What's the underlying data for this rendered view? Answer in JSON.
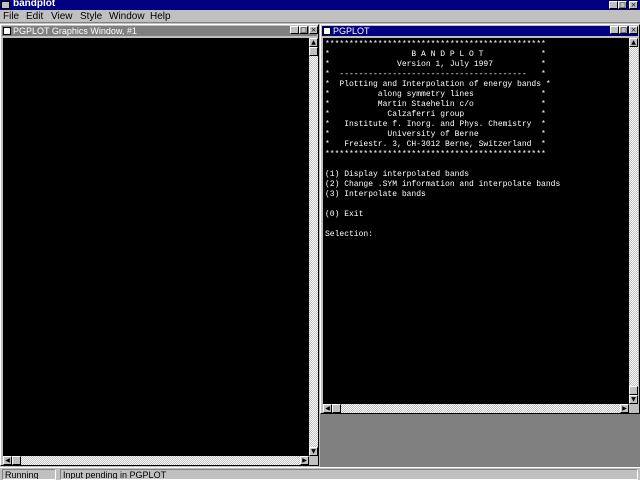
{
  "app": {
    "title": "bandplot"
  },
  "menu": [
    "File",
    "Edit",
    "View",
    "Style",
    "Window",
    "Help"
  ],
  "graphics_window": {
    "title": "PGPLOT Graphics Window, #1"
  },
  "console_window": {
    "title": "PGPLOT",
    "lines": [
      "**********************************************",
      "*                 B A N D P L O T            *",
      "*              Version 1, July 1997          *",
      "*  ---------------------------------------   *",
      "*  Plotting and Interpolation of energy bands *",
      "*          along symmetry lines              *",
      "*          Martin Staehelin c/o              *",
      "*            Calzaferri group                *",
      "*   Institute f. Inorg. and Phys. Chemistry  *",
      "*            University of Berne             *",
      "*   Freiestr. 3, CH-3012 Berne, Switzerland  *",
      "**********************************************",
      "",
      "(1) Display interpolated bands",
      "(2) Change .SYM information and interpolate bands",
      "(3) Interpolate bands",
      "",
      "(0) Exit",
      "",
      "Selection:"
    ]
  },
  "status": {
    "state": "Running",
    "message": "Input pending in PGPLOT"
  },
  "icons": [
    "app-icon",
    "minimize-icon",
    "maximize-icon",
    "close-icon",
    "scroll-up-icon",
    "scroll-down-icon",
    "scroll-left-icon",
    "scroll-right-icon"
  ],
  "colors": {
    "title_active": "#000080",
    "title_inactive": "#808080",
    "face": "#c0c0c0"
  }
}
